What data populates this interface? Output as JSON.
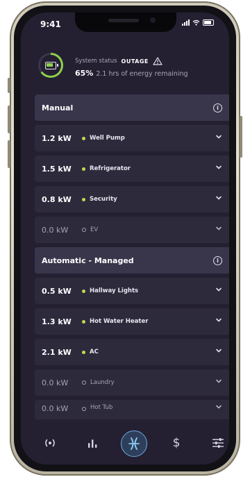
{
  "status_bar": {
    "time": "9:41"
  },
  "system": {
    "label": "System status",
    "state": "OUTAGE",
    "percent": "65%",
    "remaining": "2.1 hrs of energy remaining",
    "charge_fraction": 0.65,
    "accent": "#8fd14b"
  },
  "sections": [
    {
      "title": "Manual",
      "rows": [
        {
          "kw": "1.2 kW",
          "name": "Well Pump",
          "active": true
        },
        {
          "kw": "1.5 kW",
          "name": "Refrigerator",
          "active": true
        },
        {
          "kw": "0.8 kW",
          "name": "Security",
          "active": true
        },
        {
          "kw": "0.0 kW",
          "name": "EV",
          "active": false
        }
      ]
    },
    {
      "title": "Automatic - Managed",
      "rows": [
        {
          "kw": "0.5 kW",
          "name": "Hallway Lights",
          "active": true
        },
        {
          "kw": "1.3 kW",
          "name": "Hot Water Heater",
          "active": true
        },
        {
          "kw": "2.1 kW",
          "name": "AC",
          "active": true
        },
        {
          "kw": "0.0 kW",
          "name": "Laundry",
          "active": false
        },
        {
          "kw": "0.0 kW",
          "name": "Hot Tub",
          "active": false
        }
      ]
    }
  ],
  "tabs": [
    {
      "icon": "broadcast-icon"
    },
    {
      "icon": "bar-chart-icon"
    },
    {
      "icon": "power-flow-icon",
      "active": true
    },
    {
      "icon": "dollar-icon",
      "label": "$"
    },
    {
      "icon": "sliders-icon"
    }
  ],
  "colors": {
    "background": "#242032",
    "row": "#2d2a3c",
    "section": "#39354a",
    "active_dot": "#c7d94e",
    "tab_active": "#6fa9e0"
  }
}
